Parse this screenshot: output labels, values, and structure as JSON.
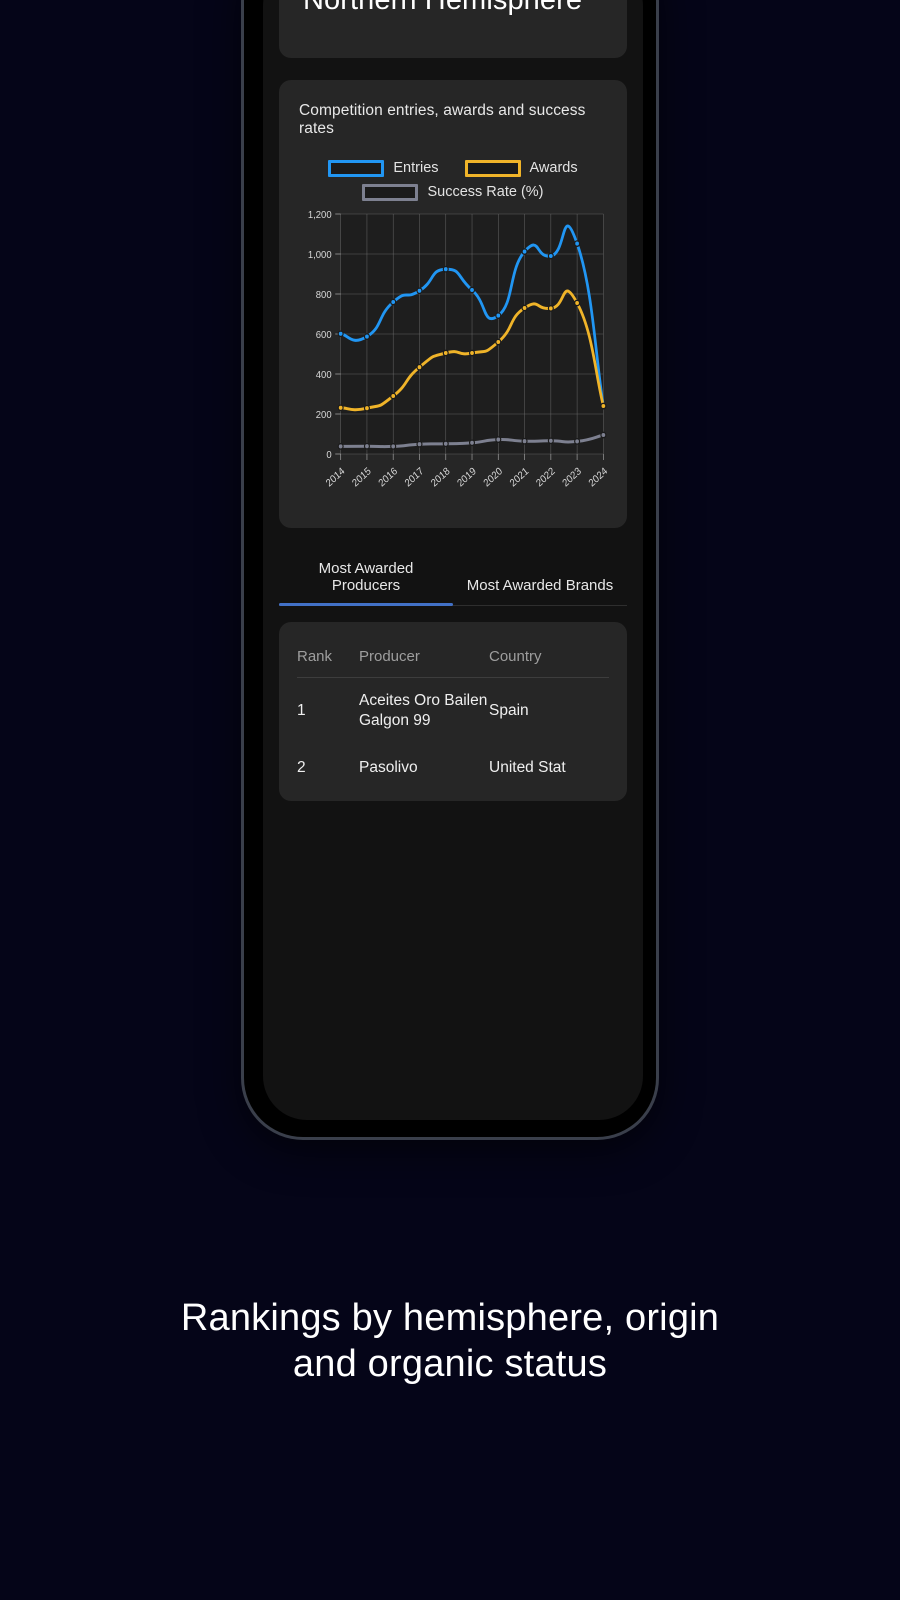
{
  "phone": {
    "hemisphere_title": "Northern Hemisphere",
    "chart_caption": "Competition entries, awards and success rates",
    "tabs": [
      {
        "label": "Most Awarded Producers",
        "active": true
      },
      {
        "label": "Most Awarded Brands",
        "active": false
      }
    ],
    "table": {
      "headers": [
        "Rank",
        "Producer",
        "Country"
      ],
      "rows": [
        {
          "rank": "1",
          "producer": "Aceites Oro Bailen Galgon 99",
          "country": "Spain"
        },
        {
          "rank": "2",
          "producer": "Pasolivo",
          "country": "United Stat"
        }
      ]
    }
  },
  "caption": {
    "line1": "Rankings by hemisphere, origin",
    "line2": "and organic status"
  },
  "colors": {
    "background": "#050518",
    "card": "#262626",
    "plot": "#1e1e1e",
    "entries": "#2196f3",
    "awards": "#f0b429",
    "success": "#7d8090",
    "tab_active": "#4271c7",
    "grid": "#6d6d6d"
  },
  "chart_data": {
    "type": "line",
    "title": "Competition entries, awards and success rates",
    "xlabel": "",
    "ylabel": "",
    "categories": [
      "2014",
      "2015",
      "2016",
      "2017",
      "2018",
      "2019",
      "2020",
      "2021",
      "2022",
      "2023",
      "2024"
    ],
    "ylim": [
      0,
      1200
    ],
    "yticks": [
      0,
      200,
      400,
      600,
      800,
      1000,
      1200
    ],
    "ytick_labels": [
      "0",
      "200",
      "400",
      "600",
      "800",
      "1,000",
      "1,200"
    ],
    "grid": true,
    "legend_position": "top",
    "series": [
      {
        "name": "Entries",
        "color": "#2196f3",
        "values": [
          601,
          587,
          760,
          816,
          924,
          820,
          692,
          1012,
          990,
          1052,
          240
        ]
      },
      {
        "name": "Awards",
        "color": "#f0b429",
        "values": [
          231,
          229,
          290,
          434,
          505,
          505,
          560,
          730,
          728,
          755,
          240
        ]
      },
      {
        "name": "Success Rate (%)",
        "color": "#7d8090",
        "values": [
          38,
          39,
          38,
          49,
          51,
          56,
          72,
          64,
          66,
          63,
          95
        ]
      }
    ]
  }
}
